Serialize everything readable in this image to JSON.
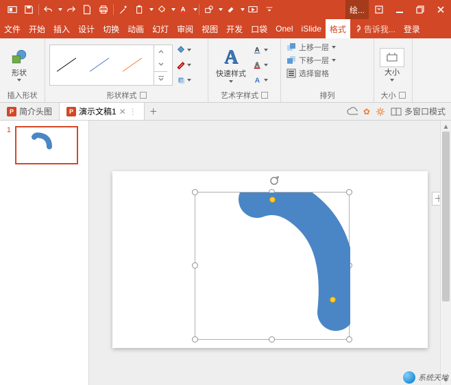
{
  "contextual_tab": "绘...",
  "tabs": {
    "file": "文件",
    "home": "开始",
    "insert": "插入",
    "design": "设计",
    "transitions": "切换",
    "animations": "动画",
    "slideshow": "幻灯",
    "review": "审阅",
    "view": "视图",
    "developer": "开发",
    "pocket": "口袋",
    "onel": "Onel",
    "islide": "iSlide",
    "format": "格式",
    "tellme": "告诉我...",
    "signin": "登录"
  },
  "ribbon": {
    "insert_shape": {
      "shape": "形状",
      "group": "插入形状"
    },
    "shape_styles": {
      "group": "形状样式"
    },
    "word_art": {
      "quick": "快速样式",
      "group": "艺术字样式"
    },
    "arrange": {
      "bring": "上移一层",
      "send": "下移一层",
      "pane": "选择窗格",
      "group": "排列"
    },
    "size": {
      "size": "大小",
      "group": "大小"
    }
  },
  "doc_tabs": {
    "tab1": "简介头图",
    "tab2": "演示文稿1",
    "multi": "多窗口模式"
  },
  "slide_panel": {
    "num1": "1"
  },
  "watermark": "系统天地"
}
